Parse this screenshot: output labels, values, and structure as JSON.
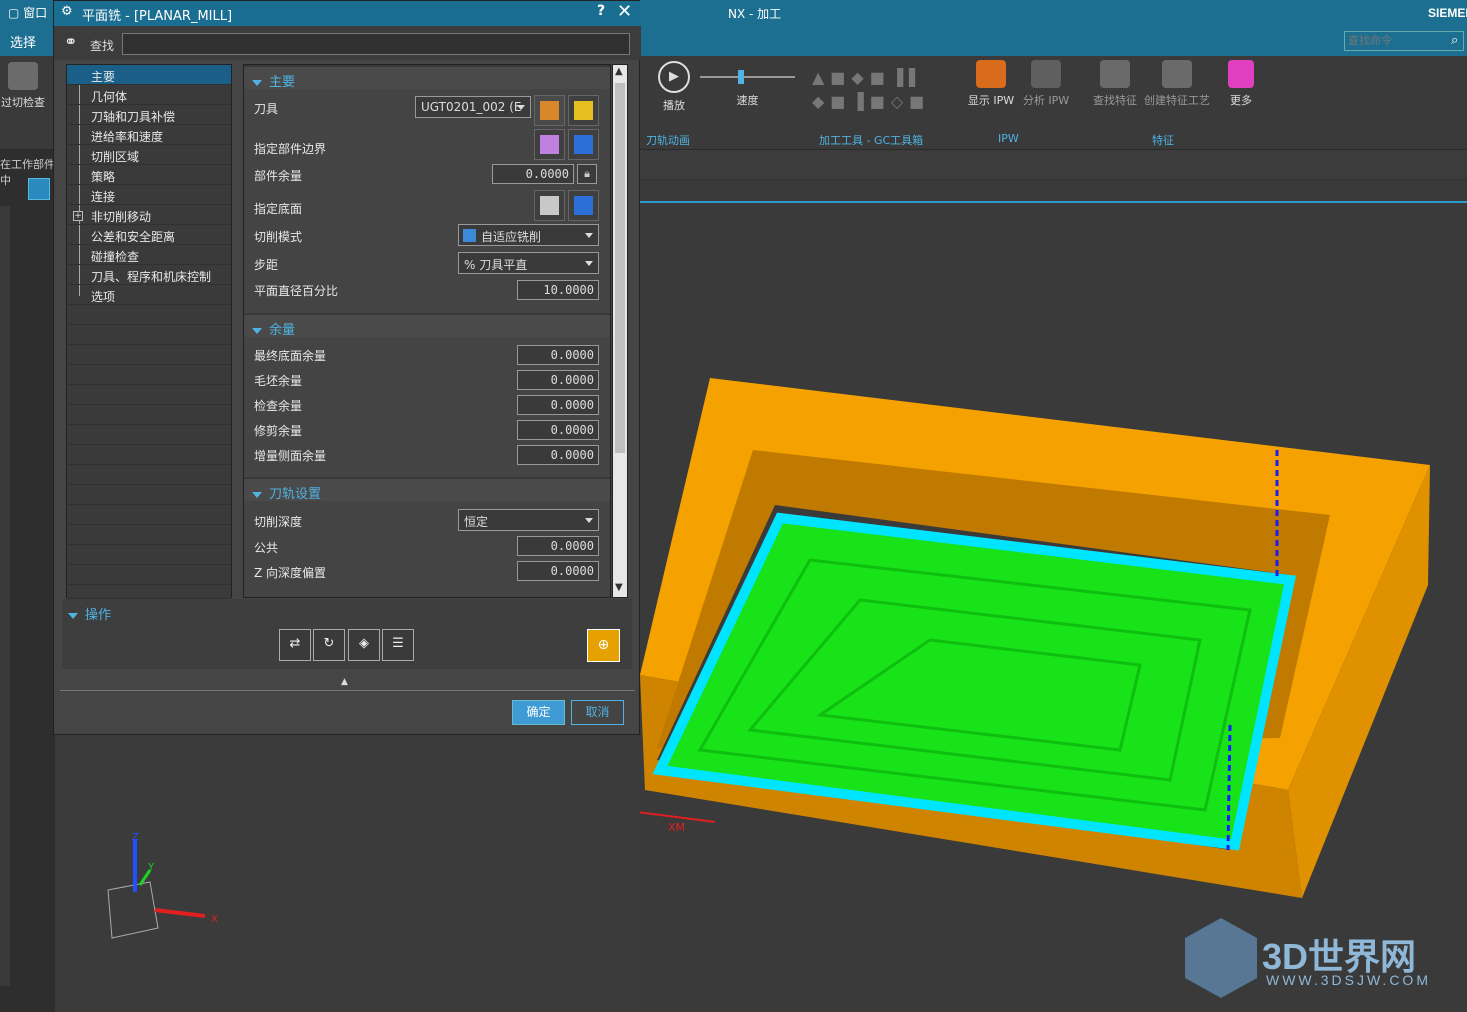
{
  "window": {
    "menu_label": "窗口",
    "app_title": "NX - 加工",
    "brand": "SIEMENS"
  },
  "ribbon": {
    "tab_select": "选择",
    "search_placeholder": "查找命令",
    "left_cmd": "过切检查",
    "play": "播放",
    "speed": "速度",
    "show_ipw": "显示 IPW",
    "analyze_ipw": "分析 IPW",
    "find_feature": "查找特征",
    "create_feature_process": "创建特征工艺",
    "more": "更多",
    "groups": [
      "刀轨动画",
      "加工工具 - GC工具箱",
      "IPW",
      "特征"
    ]
  },
  "left_strip": {
    "label": "在工作部件中"
  },
  "dialog": {
    "title": "平面铣 - [PLANAR_MILL]",
    "help": "?",
    "close": "✕",
    "find_label": "查找",
    "find_value": "",
    "tree": [
      "主要",
      "几何体",
      "刀轴和刀具补偿",
      "进给率和速度",
      "切削区域",
      "策略",
      "连接",
      "非切削移动",
      "公差和安全距离",
      "碰撞检查",
      "刀具、程序和机床控制",
      "选项"
    ],
    "sections": {
      "main": {
        "header": "主要",
        "tool_label": "刀具",
        "tool_value": "UGT0201_002 (E",
        "part_boundary_label": "指定部件边界",
        "part_stock_label": "部件余量",
        "part_stock_value": "0.0000",
        "floor_label": "指定底面",
        "cut_pattern_label": "切削模式",
        "cut_pattern_value": "自适应铣削",
        "stepover_label": "步距",
        "stepover_value": "% 刀具平直",
        "flat_percent_label": "平面直径百分比",
        "flat_percent_value": "10.0000"
      },
      "stock": {
        "header": "余量",
        "rows": [
          {
            "label": "最终底面余量",
            "value": "0.0000"
          },
          {
            "label": "毛坯余量",
            "value": "0.0000"
          },
          {
            "label": "检查余量",
            "value": "0.0000"
          },
          {
            "label": "修剪余量",
            "value": "0.0000"
          },
          {
            "label": "增量侧面余量",
            "value": "0.0000"
          }
        ]
      },
      "path": {
        "header": "刀轨设置",
        "depth_label": "切削深度",
        "depth_value": "恒定",
        "common_label": "公共",
        "common_value": "0.0000",
        "zoffset_label": "Z 向深度偏置",
        "zoffset_value": "0.0000"
      }
    },
    "ops_header": "操作",
    "ok": "确定",
    "cancel": "取消"
  },
  "viewport": {
    "axis_x": "X",
    "axis_y": "Y",
    "axis_z": "Z",
    "axis_xm": "XM"
  },
  "watermark": {
    "text": "3D世界网",
    "sub": "WWW.3DSJW.COM"
  },
  "colors": {
    "title_bar": "#1c6f91",
    "accent": "#4fb3e3",
    "part": "#f5a100",
    "toolpath": "#1aff1a",
    "cyan_path": "#00e5ff"
  }
}
